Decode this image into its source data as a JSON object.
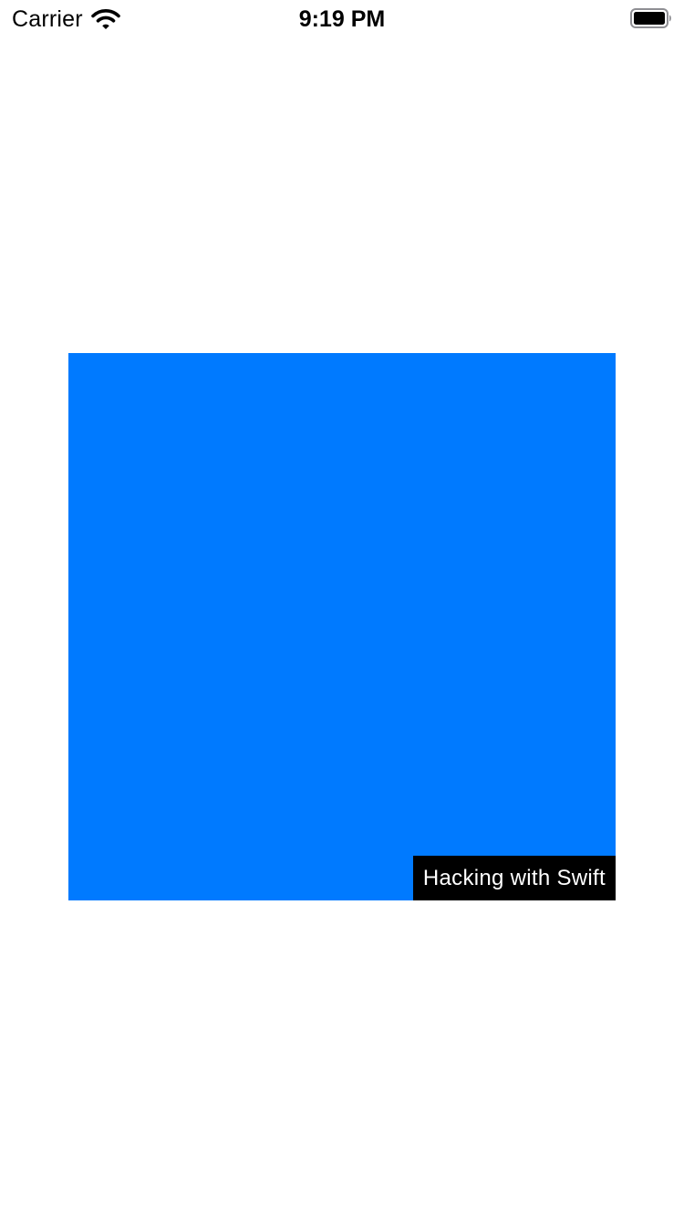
{
  "status_bar": {
    "carrier": "Carrier",
    "time": "9:19 PM",
    "icons": {
      "wifi": "wifi-icon",
      "battery": "battery-icon"
    }
  },
  "main": {
    "square_color": "#007AFF",
    "caption": "Hacking with Swift",
    "caption_background": "#000000",
    "caption_color": "#FFFFFF"
  }
}
